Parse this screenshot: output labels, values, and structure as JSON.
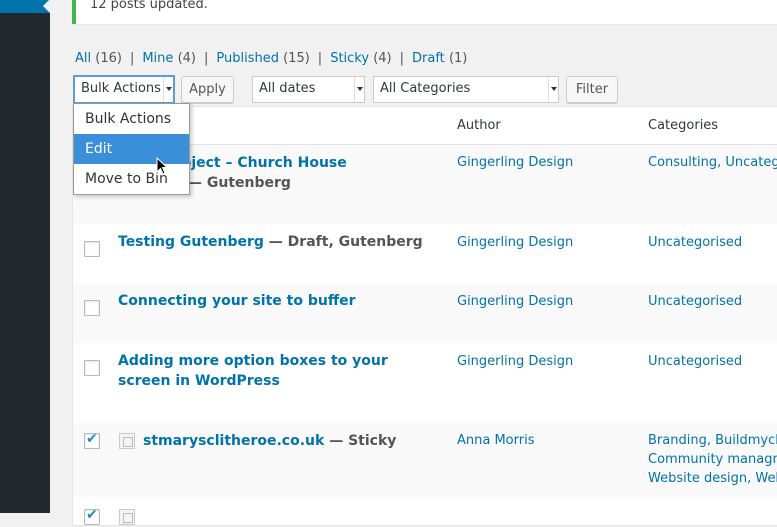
{
  "notice": {
    "text": "12 posts updated."
  },
  "filters": [
    {
      "label": "All",
      "count": "(16)"
    },
    {
      "label": "Mine",
      "count": "(4)"
    },
    {
      "label": "Published",
      "count": "(15)"
    },
    {
      "label": "Sticky",
      "count": "(4)"
    },
    {
      "label": "Draft",
      "count": "(1)"
    }
  ],
  "toolbar": {
    "bulk_actions": "Bulk Actions",
    "apply": "Apply",
    "dates": "All dates",
    "categories": "All Categories",
    "filter": "Filter"
  },
  "dropdown": {
    "options": [
      "Bulk Actions",
      "Edit",
      "Move to Bin"
    ],
    "selected": "Edit"
  },
  "table": {
    "headers": {
      "author": "Author",
      "categories": "Categories"
    },
    "rows": [
      {
        "title": "chive Project – Church House",
        "title2": "— Gutenberg",
        "author": "Gingerling Design",
        "categories": "Consulting, Uncategori",
        "checked": false
      },
      {
        "title": "Testing Gutenberg",
        "state": " — Draft, Gutenberg",
        "author": "Gingerling Design",
        "categories": "Uncategorised",
        "checked": false
      },
      {
        "title": "Connecting your site to buffer",
        "author": "Gingerling Design",
        "categories": "Uncategorised",
        "checked": false
      },
      {
        "title": "Adding more option boxes to your screen in WordPress",
        "author": "Gingerling Design",
        "categories": "Uncategorised",
        "checked": false
      },
      {
        "title": "stmarysclitheroe.co.uk",
        "state": " — Sticky",
        "author": "Anna Morris",
        "categories": "Branding, Buildmychurc",
        "categories2": "Community managmen",
        "categories3": "Website design, Webs",
        "checked": true
      }
    ]
  },
  "colors": {
    "link": "#0073aa",
    "sidebar": "#23282d",
    "notice_border": "#46b450",
    "selected": "#3b8fd9"
  }
}
